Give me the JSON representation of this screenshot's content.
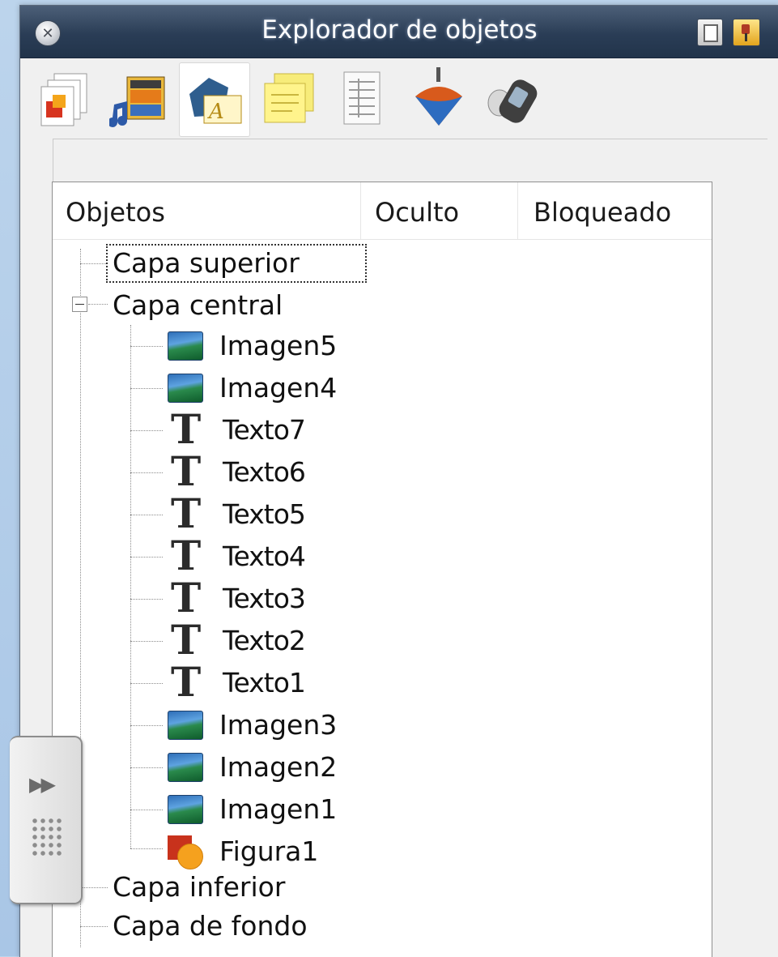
{
  "window": {
    "title": "Explorador de objetos",
    "close_icon": "close-icon",
    "doc_button_icon": "document-icon",
    "pin_button_icon": "pin-icon"
  },
  "toolbar": {
    "tools": [
      {
        "name": "pages",
        "icon": "pages-icon",
        "active": false
      },
      {
        "name": "multimedia",
        "icon": "film-music-icon",
        "active": false
      },
      {
        "name": "objects",
        "icon": "objects-icon",
        "active": true
      },
      {
        "name": "notes",
        "icon": "sticky-note-icon",
        "active": false
      },
      {
        "name": "properties",
        "icon": "property-sheet-icon",
        "active": false
      },
      {
        "name": "spinner",
        "icon": "spinning-top-icon",
        "active": false
      },
      {
        "name": "devices",
        "icon": "device-icon",
        "active": false
      }
    ]
  },
  "tree": {
    "columns": [
      "Objetos",
      "Oculto",
      "Bloqueado"
    ],
    "layers": {
      "top": "Capa superior",
      "central": "Capa central",
      "bottom": "Capa inferior",
      "background": "Capa de fondo"
    },
    "central_children": [
      {
        "label": "Imagen5",
        "type": "image"
      },
      {
        "label": "Imagen4",
        "type": "image"
      },
      {
        "label": "Texto7",
        "type": "text"
      },
      {
        "label": "Texto6",
        "type": "text"
      },
      {
        "label": "Texto5",
        "type": "text"
      },
      {
        "label": "Texto4",
        "type": "text"
      },
      {
        "label": "Texto3",
        "type": "text"
      },
      {
        "label": "Texto2",
        "type": "text"
      },
      {
        "label": "Texto1",
        "type": "text"
      },
      {
        "label": "Imagen3",
        "type": "image"
      },
      {
        "label": "Imagen2",
        "type": "image"
      },
      {
        "label": "Imagen1",
        "type": "image"
      },
      {
        "label": "Figura1",
        "type": "shape"
      }
    ]
  },
  "side_tab": {
    "arrows": "▶▶"
  }
}
